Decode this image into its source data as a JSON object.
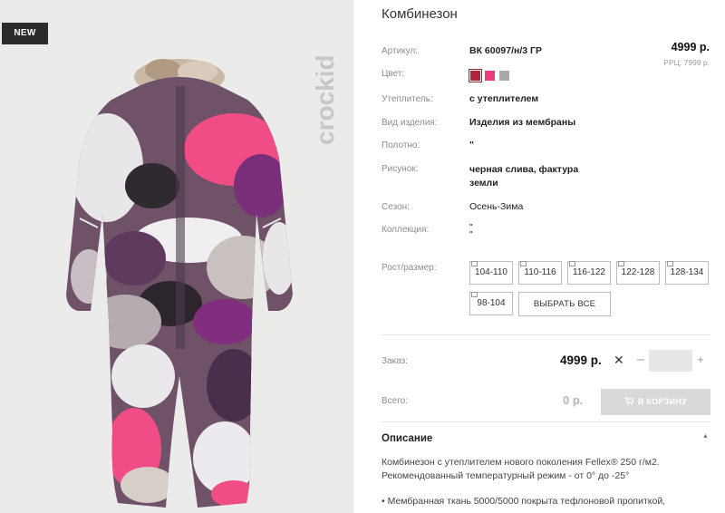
{
  "badge": "NEW",
  "brand": "crockid",
  "product": {
    "title": "Комбинезон",
    "price": "4999 р.",
    "rrp": "РРЦ: 7999 р."
  },
  "attributes": [
    {
      "label": "Артикул:",
      "value": "ВК 60097/н/3 ГР"
    },
    {
      "label": "Цвет:"
    },
    {
      "label": "Утеплитель:",
      "value": "с утеплителем"
    },
    {
      "label": "Вид изделия:",
      "value": "Изделия из мембраны"
    },
    {
      "label": "Полотно:",
      "value": "\""
    },
    {
      "label": "Рисунок:",
      "value_line1": "черная слива, фактура",
      "value_line2": "земли"
    },
    {
      "label": "Сезон:",
      "value": "Осень-Зима"
    },
    {
      "label": "Коллекция:",
      "value_line1": "\"",
      "value_line2": "\""
    },
    {
      "label": "Рост/размер:"
    }
  ],
  "colors": [
    "#b3243a",
    "#ec3c7e",
    "#a9a9a9"
  ],
  "sizes": [
    "104-110",
    "110-116",
    "116-122",
    "122-128",
    "128-134",
    "98-104"
  ],
  "select_all": "ВЫБРАТЬ ВСЕ",
  "order": {
    "label": "Заказ:",
    "price": "4999 р.",
    "times": "✕",
    "minus": "–",
    "plus": "+",
    "quantity": ""
  },
  "total": {
    "label": "Всего:",
    "value": "0 р.",
    "cart_button": "В КОРЗИНУ"
  },
  "description": {
    "title": "Описание",
    "caret": "▲",
    "line1": "Комбинезон с утеплителем нового поколения Fellex® 250 г/м2.",
    "line2": "Рекомендованный температурный режим - от 0° до -25°",
    "line3": "• Мембранная ткань 5000/5000 покрыта тефлоновой пропиткой,"
  }
}
